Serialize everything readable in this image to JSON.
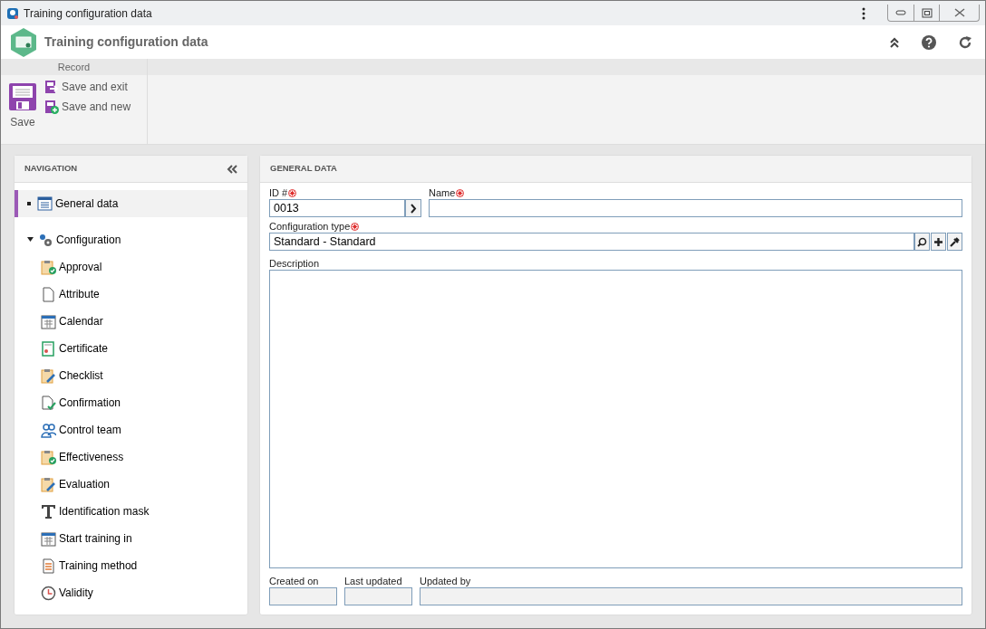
{
  "window": {
    "title": "Training configuration data"
  },
  "header": {
    "title": "Training configuration data"
  },
  "ribbon": {
    "group": "Record",
    "buttons": [
      {
        "label": "Save",
        "kind": "save"
      },
      {
        "label": "Save and exit",
        "kind": "exit"
      },
      {
        "label": "Save and new",
        "kind": "new"
      }
    ]
  },
  "navigation": {
    "title": "NAVIGATION",
    "items": [
      {
        "label": "General data",
        "kind": "list",
        "selected": true
      },
      {
        "label": "Configuration",
        "kind": "gears",
        "selected": false,
        "expanded": true,
        "children": [
          {
            "label": "Approval",
            "kind": "clipcheck",
            "selected": false
          },
          {
            "label": "Attribute",
            "kind": "page",
            "selected": false
          },
          {
            "label": "Calendar",
            "kind": "calendar",
            "selected": false
          },
          {
            "label": "Certificate",
            "kind": "certificate",
            "selected": false
          },
          {
            "label": "Checklist",
            "kind": "clippen",
            "selected": false
          },
          {
            "label": "Confirmation",
            "kind": "pagecheck",
            "selected": false
          },
          {
            "label": "Control team",
            "kind": "team",
            "selected": false
          },
          {
            "label": "Effectiveness",
            "kind": "clipcheck",
            "selected": false
          },
          {
            "label": "Evaluation",
            "kind": "clippen",
            "selected": false
          },
          {
            "label": "Identification mask",
            "kind": "text",
            "selected": false
          },
          {
            "label": "Start training in",
            "kind": "calendar",
            "selected": false
          },
          {
            "label": "Training method",
            "kind": "doc",
            "selected": false
          },
          {
            "label": "Validity",
            "kind": "clock",
            "selected": false
          }
        ]
      }
    ]
  },
  "general_data": {
    "title": "GENERAL DATA",
    "id": {
      "label": "ID #",
      "required": true,
      "value": "0013"
    },
    "name": {
      "label": "Name",
      "required": true
    },
    "configuration_type": {
      "label": "Configuration type",
      "required": true,
      "value": "Standard - Standard"
    },
    "description": {
      "label": "Description"
    },
    "footer_fields": [
      {
        "label": "Created on",
        "disabled": true
      },
      {
        "label": "Last updated",
        "disabled": true
      },
      {
        "label": "Updated by",
        "disabled": true
      }
    ]
  }
}
